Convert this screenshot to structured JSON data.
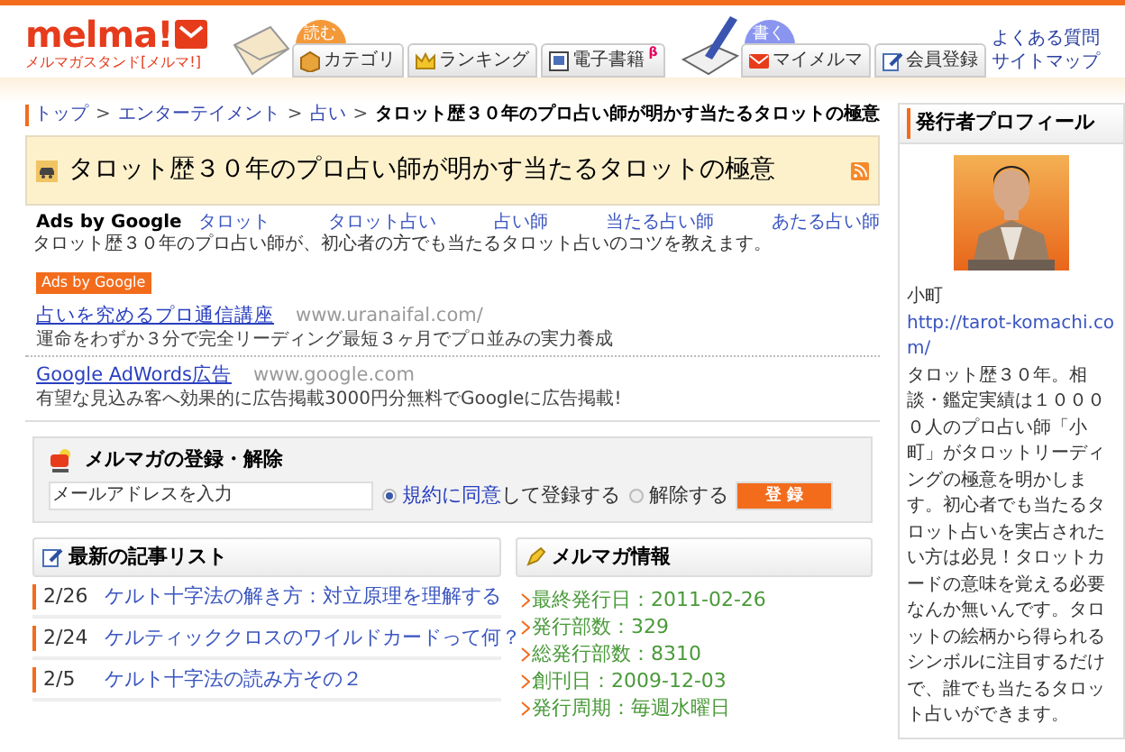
{
  "header": {
    "logo": "melma!",
    "logo_subtitle": "メルマガスタンド[メルマ!]",
    "read_label": "読む",
    "write_label": "書く",
    "read_tabs": [
      {
        "label": "カテゴリ"
      },
      {
        "label": "ランキング"
      },
      {
        "label": "電子書籍",
        "badge": "β"
      }
    ],
    "write_tabs": [
      {
        "label": "マイメルマ"
      },
      {
        "label": "会員登録"
      }
    ],
    "links": [
      "よくある質問",
      "サイトマップ"
    ]
  },
  "breadcrumb": [
    "トップ",
    "エンターテイメント",
    "占い"
  ],
  "breadcrumb_separator": ">",
  "breadcrumb_current": "タロット歴３０年のプロ占い師が明かす当たるタロットの極意",
  "title": "タロット歴３０年のプロ占い師が明かす当たるタロットの極意",
  "ads_bar": {
    "label": "Ads by Google",
    "links": [
      "タロット",
      "タロット占い",
      "占い師",
      "当たる占い師",
      "あたる占い師"
    ]
  },
  "description": "タロット歴３０年のプロ占い師が、初心者の方でも当たるタロット占いのコツを教えます。",
  "ads": {
    "badge": "Ads by Google",
    "items": [
      {
        "title": "占いを究めるプロ通信講座",
        "url": "www.uranaifal.com/",
        "text": "運命をわずか３分で完全リーディング最短３ヶ月でプロ並みの実力養成"
      },
      {
        "title": "Google AdWords広告",
        "url": "www.google.com",
        "text": "有望な見込み客へ効果的に広告掲載3000円分無料でGoogleに広告掲載!"
      }
    ]
  },
  "subscribe": {
    "title": "メルマガの登録・解除",
    "placeholder": "メールアドレスを入力",
    "options": [
      {
        "link": "規約に同意",
        "label": "して登録する",
        "selected": true
      },
      {
        "label": "解除する",
        "selected": false
      }
    ],
    "button": "登 録"
  },
  "articles": {
    "title": "最新の記事リスト",
    "items": [
      {
        "date": "2/26",
        "title": "ケルト十字法の解き方：対立原理を理解する"
      },
      {
        "date": "2/24",
        "title": "ケルティッククロスのワイルドカードって何？"
      },
      {
        "date": "2/5",
        "title": "ケルト十字法の読み方その２"
      }
    ]
  },
  "info": {
    "title": "メルマガ情報",
    "items": [
      "最終発行日：2011-02-26",
      "発行部数：329",
      "総発行部数：8310",
      "創刊日：2009-12-03",
      "発行周期：毎週水曜日"
    ]
  },
  "profile": {
    "title": "発行者プロフィール",
    "name": "小町",
    "url": "http://tarot-komachi.com/",
    "bio": "タロット歴３０年。相談・鑑定実績は１００００人のプロ占い師「小町」がタロットリーディングの極意を明かします。初心者でも当たるタロット占いを実占されたい方は必見！タロットカードの意味を覚える必要なんか無いんです。タロットの絵柄から得られるシンボルに注目するだけで、誰でも当たるタロット占いができます。"
  }
}
